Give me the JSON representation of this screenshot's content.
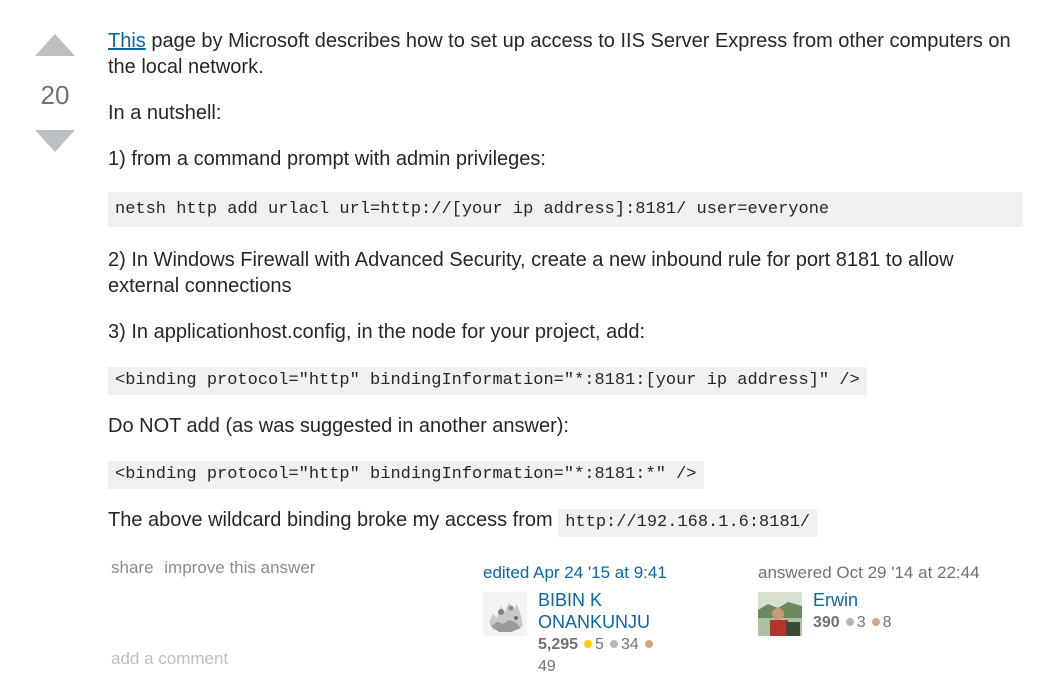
{
  "vote": {
    "count": "20"
  },
  "post": {
    "p1_link": "This",
    "p1_rest": " page by Microsoft describes how to set up access to IIS Server Express from other computers on the local network.",
    "p2": "In a nutshell:",
    "p3": "1) from a command prompt with admin privileges:",
    "code1": "netsh http add urlacl url=http://[your ip address]:8181/ user=everyone",
    "p4": "2) In Windows Firewall with Advanced Security, create a new inbound rule for port 8181 to allow external connections",
    "p5": "3) In applicationhost.config, in the node for your project, add:",
    "code2": "<binding protocol=\"http\" bindingInformation=\"*:8181:[your ip address]\" />",
    "p6": "Do NOT add (as was suggested in another answer):",
    "code3": "<binding protocol=\"http\" bindingInformation=\"*:8181:*\" />",
    "p7_text": "The above wildcard binding broke my access from ",
    "p7_code": "http://192.168.1.6:8181/"
  },
  "menu": {
    "share": "share",
    "improve": "improve this answer"
  },
  "editor": {
    "action": "edited Apr 24 '15 at 9:41",
    "name": "BIBIN K ONANKUNJU",
    "rep": "5,295",
    "gold": "5",
    "silver": "34",
    "bronze": "49"
  },
  "author": {
    "action": "answered Oct 29 '14 at 22:44",
    "name": "Erwin",
    "rep": "390",
    "silver": "3",
    "bronze": "8"
  },
  "comments": {
    "add": "add a comment"
  },
  "colors": {
    "link": "#0c65a5",
    "gold": "#ffcc01",
    "silver": "#b4b8bc",
    "bronze": "#d1a684",
    "code_bg": "#eff0f1"
  }
}
